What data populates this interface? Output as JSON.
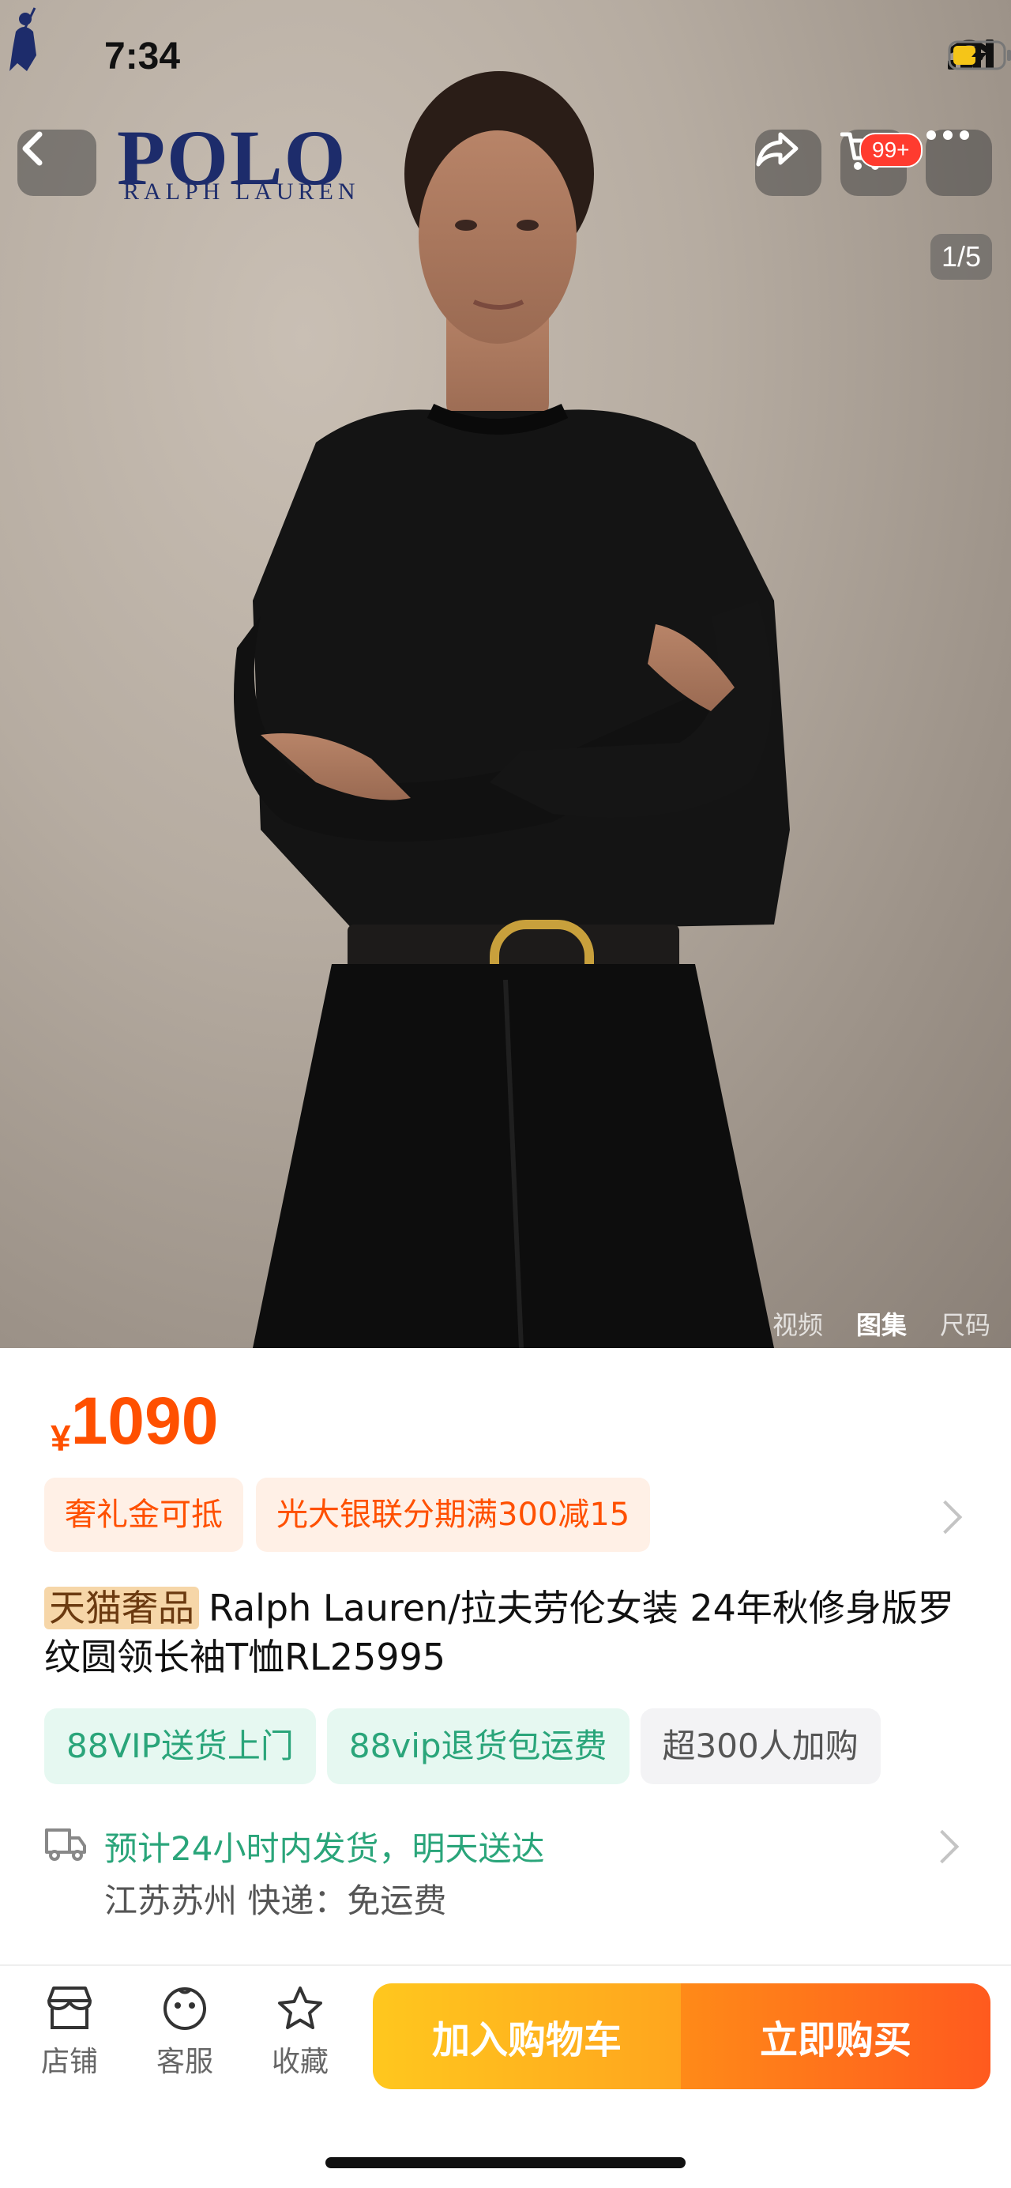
{
  "status_bar": {
    "time": "7:34"
  },
  "header": {
    "brand_logo": {
      "polo": "POLO",
      "sub": "RALPH LAUREN"
    },
    "cart_badge": "99+",
    "image_counter": "1/5"
  },
  "media_tabs": [
    {
      "label": "视频",
      "active": false
    },
    {
      "label": "图集",
      "active": true
    },
    {
      "label": "尺码",
      "active": false
    }
  ],
  "product": {
    "currency": "¥",
    "price": "1090",
    "promos": [
      "奢礼金可抵",
      "光大银联分期满300减15"
    ],
    "brand_tag": "天猫奢品",
    "title": "Ralph Lauren/拉夫劳伦女装 24年秋修身版罗纹圆领长袖T恤RL25995",
    "tags": [
      {
        "label": "88VIP送货上门",
        "style": "green"
      },
      {
        "label": "88vip退货包运费",
        "style": "green"
      },
      {
        "label": "超300人加购",
        "style": "gray"
      }
    ],
    "shipping": {
      "line1": "预计24小时内发货，明天送达",
      "line2": "江苏苏州  快递：免运费"
    }
  },
  "bottom_bar": {
    "store": "店铺",
    "service": "客服",
    "favorite": "收藏",
    "add_to_cart": "加入购物车",
    "buy_now": "立即购买"
  },
  "colors": {
    "accent": "#ff5000",
    "green": "#2aa57a",
    "brand_navy": "#1d2c6b"
  },
  "icons": [
    "back-icon",
    "share-icon",
    "cart-icon",
    "more-icon",
    "store-icon",
    "service-icon",
    "star-icon",
    "truck-icon"
  ]
}
